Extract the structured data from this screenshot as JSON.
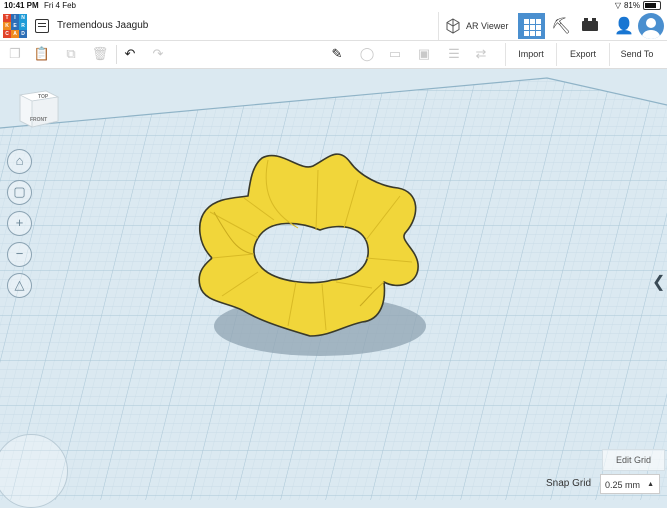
{
  "status_bar": {
    "time": "10:41 PM",
    "date": "Fri 4 Feb",
    "battery": "81%",
    "battery_level": 0.81
  },
  "app": {
    "logo_letters": [
      "T",
      "I",
      "N",
      "K",
      "E",
      "R",
      "C",
      "A",
      "D"
    ],
    "project_title": "Tremendous Jaagub"
  },
  "header": {
    "ar_viewer_label": "AR Viewer"
  },
  "toolbar": {
    "import_label": "Import",
    "export_label": "Export",
    "send_to_label": "Send To"
  },
  "viewcube": {
    "top_label": "TOP",
    "front_label": "FRONT"
  },
  "grid_controls": {
    "edit_grid_label": "Edit Grid",
    "snap_grid_label": "Snap Grid",
    "snap_grid_value": "0.25 mm"
  },
  "icons": [
    "document-icon",
    "ar-cube-icon",
    "grid-view-icon",
    "pickaxe-icon",
    "brick-icon",
    "add-user-icon",
    "avatar-icon",
    "copy-icon",
    "paste-icon",
    "duplicate-icon",
    "trash-icon",
    "undo-icon",
    "redo-icon",
    "note-icon",
    "light-icon",
    "shape-icon",
    "group-icon",
    "align-icon",
    "flip-icon",
    "home-icon",
    "fit-icon",
    "zoom-in-icon",
    "zoom-out-icon",
    "perspective-icon"
  ],
  "colors": {
    "accent": "#4a8fcf",
    "shape": "#f1d63a",
    "grid": "#dbe9f1"
  }
}
